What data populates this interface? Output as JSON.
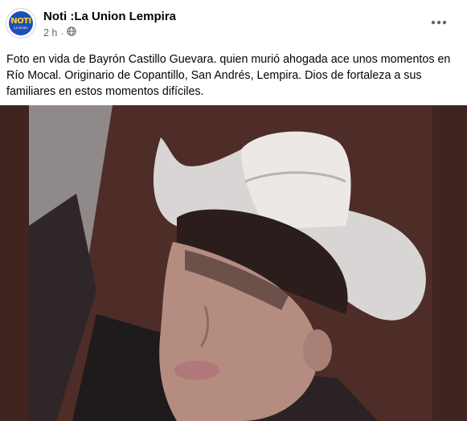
{
  "post": {
    "author": "Noti :La Union Lempira",
    "time": "2 h",
    "separator": "·",
    "audience_icon": "globe-icon",
    "more_icon": "more-options-icon",
    "caption": "Foto en vida de Bayrón Castillo Guevara.  quien murió ahogada ace unos momentos en Río Mocal. Originario de Copantillo, San Andrés, Lempira. Dios de fortaleza a sus familiares en estos momentos difíciles."
  },
  "avatar": {
    "logo_main": "NOTI",
    "logo_sub": "La Union",
    "colors": {
      "background": "#1d4fb8",
      "text": "#ffd21a"
    }
  },
  "colors": {
    "page_background": "#ffffff",
    "primary_text": "#050505",
    "secondary_text": "#65676b",
    "photo_background": "#4a2a25"
  }
}
